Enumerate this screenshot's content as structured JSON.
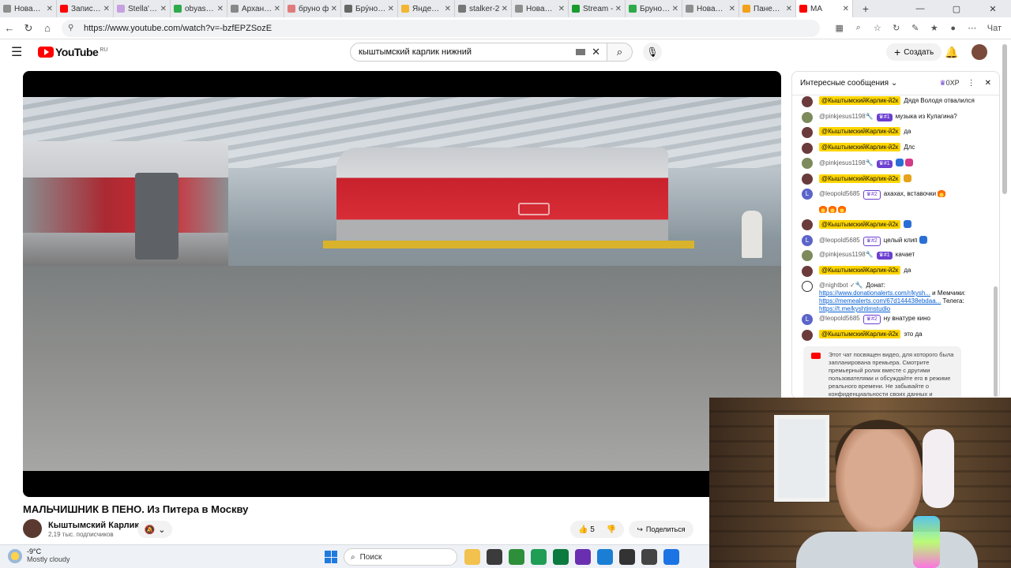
{
  "browser": {
    "tabs": [
      {
        "title": "Новая вкл",
        "color": "#8e8e8e"
      },
      {
        "title": "Запись на",
        "color": "#ff0000"
      },
      {
        "title": "Stella's Ar",
        "color": "#c6a0e0"
      },
      {
        "title": "obyasnity",
        "color": "#2eaa4a"
      },
      {
        "title": "Архангел",
        "color": "#888888"
      },
      {
        "title": "бруно ф",
        "color": "#e07b7b"
      },
      {
        "title": "Брýно — ",
        "color": "#666666"
      },
      {
        "title": "Яндекс М",
        "color": "#f2b632"
      },
      {
        "title": "stalker-2",
        "color": "#777777"
      },
      {
        "title": "Новая вкл",
        "color": "#8e8e8e"
      },
      {
        "title": "Stream -",
        "color": "#1a9b2e"
      },
      {
        "title": "Бруно (2",
        "color": "#2eaa4a"
      },
      {
        "title": "Новая вкл",
        "color": "#8e8e8e"
      },
      {
        "title": "Панель у",
        "color": "#f2a11b"
      },
      {
        "title": "MA",
        "color": "#ff0000"
      }
    ],
    "url": "https://www.youtube.com/watch?v=-bzfEPZSozE",
    "chat_label": "Чат",
    "new_tab_symbol": "+",
    "close_symbol": "✕"
  },
  "youtube": {
    "logo_text": "YouTube",
    "region": "RU",
    "search_query": "кыштымский карлик нижний",
    "create_label": "Создать"
  },
  "video": {
    "title": "МАЛЬЧИШНИК В ПЕНО. Из Питера в Москву",
    "channel": "Кыштымский Карлик",
    "subscribers": "2,19 тыс. подписчиков",
    "likes": "5",
    "share_label": "Поделиться"
  },
  "chat": {
    "mode": "Интересные сообщения",
    "xp": "0XP",
    "messages": [
      {
        "author": "@КыштымскийКарлик-й2к",
        "style": "hl",
        "avatar": "",
        "badges": [],
        "text": "Дядя Володя отвалился"
      },
      {
        "author": "@pinkjesus1198🔧",
        "style": "plain",
        "avatar": "eye",
        "badges": [
          "#1"
        ],
        "text": "музыка из Кулагина?"
      },
      {
        "author": "@КыштымскийКарлик-й2к",
        "style": "hl",
        "avatar": "",
        "badges": [],
        "text": "да"
      },
      {
        "author": "@КыштымскийКарлик-й2к",
        "style": "hl",
        "avatar": "",
        "badges": [],
        "text": "Длс"
      },
      {
        "author": "@pinkjesus1198🔧",
        "style": "plain",
        "avatar": "eye",
        "badges": [
          "#1"
        ],
        "text": "",
        "emoji": [
          "cap",
          "heart"
        ]
      },
      {
        "author": "@КыштымскийКарлик-й2к",
        "style": "hl",
        "avatar": "",
        "badges": [],
        "text": "",
        "emoji": [
          "coin"
        ]
      },
      {
        "author": "@leopold5685",
        "style": "plain",
        "avatar": "L",
        "badges": [
          "#2"
        ],
        "text": "ахахах, вставочки",
        "emoji": [
          "fire"
        ]
      },
      {
        "author": "",
        "style": "none",
        "avatar": "none",
        "badges": [],
        "text": "",
        "emoji": [
          "fire",
          "fire",
          "fire"
        ]
      },
      {
        "author": "@КыштымскийКарлик-й2к",
        "style": "hl",
        "avatar": "",
        "badges": [],
        "text": "",
        "emoji": [
          "cap"
        ]
      },
      {
        "author": "@leopold5685",
        "style": "plain",
        "avatar": "L",
        "badges": [
          "#2"
        ],
        "text": "целый клип",
        "emoji": [
          "cap"
        ]
      },
      {
        "author": "@pinkjesus1198🔧",
        "style": "plain",
        "avatar": "eye",
        "badges": [
          "#1"
        ],
        "text": "качает"
      },
      {
        "author": "@КыштымскийКарлик-й2к",
        "style": "hl",
        "avatar": "",
        "badges": [],
        "text": "да"
      },
      {
        "author": "@leopold5685",
        "style": "plain",
        "avatar": "L",
        "badges": [
          "#2"
        ],
        "text": "ну внатуре кино"
      },
      {
        "author": "@КыштымскийКарлик-й2к",
        "style": "hl",
        "avatar": "",
        "badges": [],
        "text": "это да"
      }
    ],
    "bot": {
      "author": "@nightbot ✓🔧",
      "prefix": "Донат: ",
      "link1": "https://www.donationalerts.com/r/kysh...",
      "mid": " и Мемчики: ",
      "link2": "https://memealerts.com/67d144438ebdaa...",
      "mid2": " Телега: ",
      "link3": "https://t.me/kyshtimstudio"
    },
    "notice": "Этот чат посвящен видео, для которого была запланирована премьера. Смотрите премьерный ролик вместе с другими пользователями и обсуждайте его в режиме реального времени. Не забывайте о конфиденциальности своих данных и соблюдайте..."
  },
  "taskbar": {
    "temp": "-9°C",
    "weather": "Mostly cloudy",
    "search_label": "Поиск",
    "apps": [
      "#f2c14e",
      "#3b3b3b",
      "#2d8f3a",
      "#1f9d55",
      "#0b7a3e",
      "#6a2fb0",
      "#1a7fd4",
      "#333333",
      "#444444",
      "#1b74e4"
    ]
  }
}
